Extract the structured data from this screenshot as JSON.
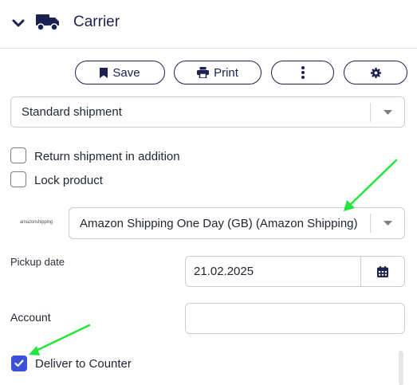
{
  "header": {
    "title": "Carrier",
    "icons": [
      "chevron-down-icon",
      "truck-icon"
    ]
  },
  "toolbar": {
    "save_label": "Save",
    "print_label": "Print",
    "icons": [
      "bookmark-icon",
      "printer-icon",
      "more-vertical-icon",
      "gear-icon"
    ]
  },
  "shipment_type": {
    "value": "Standard shipment"
  },
  "options": {
    "return_shipment": {
      "label": "Return shipment in addition",
      "checked": false
    },
    "lock_product": {
      "label": "Lock product",
      "checked": false
    }
  },
  "carrier": {
    "logo_text": "amazonshipping",
    "service": "Amazon Shipping One Day (GB) (Amazon Shipping)"
  },
  "pickup": {
    "label": "Pickup date",
    "value": "21.02.2025"
  },
  "account": {
    "label": "Account",
    "value": ""
  },
  "deliver_to_counter": {
    "label": "Deliver to Counter",
    "checked": true
  },
  "colors": {
    "accent": "#3b52d6",
    "brand_navy": "#1b2150",
    "annotation_arrow": "#22e63a"
  }
}
